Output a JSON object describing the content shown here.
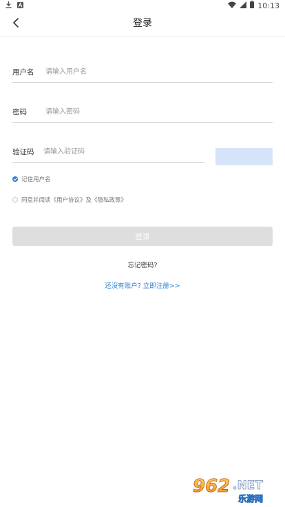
{
  "status_bar": {
    "time": "10:13",
    "icons": [
      "download-icon",
      "a-badge-icon",
      "wifi-icon",
      "signal-icon",
      "battery-icon"
    ]
  },
  "nav": {
    "title": "登录",
    "back_icon": "chevron-left-icon"
  },
  "form": {
    "username": {
      "label": "用户名",
      "placeholder": "请输入用户名",
      "value": ""
    },
    "password": {
      "label": "密码",
      "placeholder": "请输入密码",
      "value": ""
    },
    "captcha": {
      "label": "验证码",
      "placeholder": "请输入验证码",
      "value": ""
    }
  },
  "options": {
    "remember": {
      "label": "记住用户名",
      "checked": true
    },
    "agree": {
      "label": "同意并阅读《用户协议》及《隐私政策》",
      "checked": false
    }
  },
  "actions": {
    "login_label": "登录",
    "forgot_label": "忘记密码?",
    "register_label": "还没有账户? 立即注册>>"
  },
  "watermark": {
    "brand": "962.NET",
    "sub": "乐游网"
  },
  "colors": {
    "accent": "#3a7bd5",
    "link": "#2f7fd0",
    "captcha_bg": "#d6e4fb",
    "button_disabled": "#dedede"
  }
}
